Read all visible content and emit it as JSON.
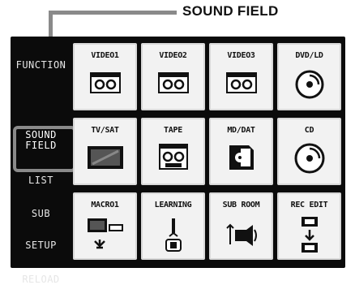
{
  "callout": {
    "label": "SOUND FIELD"
  },
  "sidebar": {
    "items": [
      {
        "label": "FUNCTION"
      },
      {
        "label_line1": "SOUND",
        "label_line2": "FIELD"
      },
      {
        "label": "LIST"
      },
      {
        "label": "SUB"
      },
      {
        "label": "SETUP"
      },
      {
        "label": "RELOAD"
      }
    ]
  },
  "tiles": [
    {
      "label": "VIDEO1",
      "icon": "cassette-icon"
    },
    {
      "label": "VIDEO2",
      "icon": "cassette-icon"
    },
    {
      "label": "VIDEO3",
      "icon": "cassette-icon"
    },
    {
      "label": "DVD/LD",
      "icon": "disc-icon"
    },
    {
      "label": "TV/SAT",
      "icon": "tv-icon"
    },
    {
      "label": "TAPE",
      "icon": "cassette-icon"
    },
    {
      "label": "MD/DAT",
      "icon": "minidisc-icon"
    },
    {
      "label": "CD",
      "icon": "disc-icon"
    },
    {
      "label": "MACRO1",
      "icon": "macro-icon"
    },
    {
      "label": "LEARNING",
      "icon": "learning-icon"
    },
    {
      "label": "SUB ROOM",
      "icon": "subroom-icon"
    },
    {
      "label": "REC EDIT",
      "icon": "rec-edit-icon"
    }
  ]
}
